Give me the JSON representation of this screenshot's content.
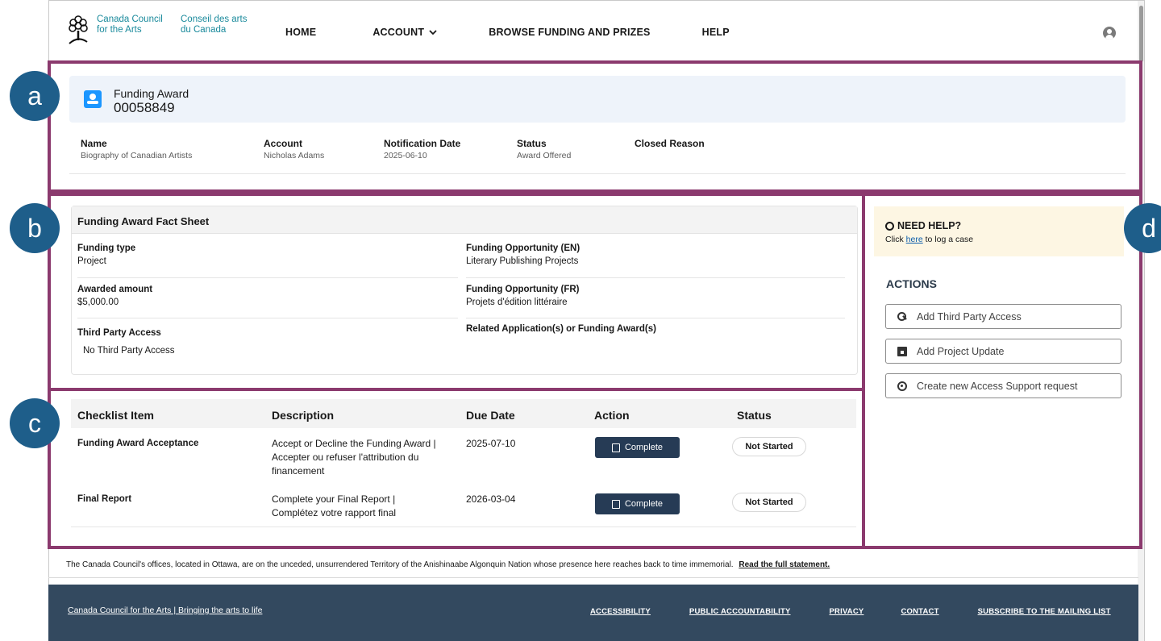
{
  "logo": {
    "en_line1": "Canada Council",
    "en_line2": "for the Arts",
    "fr_line1": "Conseil des arts",
    "fr_line2": "du Canada",
    "icon": "tree-logo-icon"
  },
  "nav": {
    "home": "HOME",
    "account": "ACCOUNT",
    "browse": "BROWSE FUNDING AND PRIZES",
    "help": "HELP"
  },
  "annotations": {
    "a": "a",
    "b": "b",
    "c": "c",
    "d": "d"
  },
  "record": {
    "type": "Funding Award",
    "number": "00058849",
    "highlights": {
      "name_label": "Name",
      "name_value": "Biography of Canadian Artists",
      "account_label": "Account",
      "account_value": "Nicholas Adams",
      "date_label": "Notification Date",
      "date_value": "2025-06-10",
      "status_label": "Status",
      "status_value": "Award Offered",
      "closed_label": "Closed Reason",
      "closed_value": ""
    }
  },
  "fact_sheet": {
    "title": "Funding Award Fact Sheet",
    "funding_type_label": "Funding type",
    "funding_type_value": "Project",
    "awarded_label": "Awarded amount",
    "awarded_value": "$5,000.00",
    "tpa_label": "Third Party Access",
    "tpa_value": "No Third Party Access",
    "opp_en_label": "Funding Opportunity (EN)",
    "opp_en_value": "Literary Publishing Projects",
    "opp_fr_label": "Funding Opportunity (FR)",
    "opp_fr_value": "Projets d'édition littéraire",
    "related_label": "Related Application(s) or Funding Award(s)"
  },
  "checklist": {
    "headers": {
      "item": "Checklist Item",
      "description": "Description",
      "due": "Due Date",
      "action": "Action",
      "status": "Status"
    },
    "rows": [
      {
        "item": "Funding Award Acceptance",
        "description": "Accept or Decline the Funding Award | Accepter ou refuser l'attribution du financement",
        "due": "2025-07-10",
        "action": "Complete",
        "status": "Not Started"
      },
      {
        "item": "Final Report",
        "description": "Complete your Final Report | Complétez votre rapport final",
        "due": "2026-03-04",
        "action": "Complete",
        "status": "Not Started"
      }
    ]
  },
  "sidebar": {
    "help_title": "NEED HELP?",
    "help_prefix": "Click",
    "help_link": "here",
    "help_suffix": "to log a case",
    "actions_title": "ACTIONS",
    "actions": [
      {
        "label": "Add Third Party Access",
        "icon": "key-icon"
      },
      {
        "label": "Add Project Update",
        "icon": "calendar-icon"
      },
      {
        "label": "Create new Access Support request",
        "icon": "lifebuoy-icon"
      }
    ]
  },
  "footer": {
    "land_ack": "The Canada Council's offices, located in Ottawa, are on the unceded, unsurrendered Territory of the Anishinaabe Algonquin Nation whose presence here reaches back to time immemorial.",
    "land_ack_link": "Read the full statement.",
    "brand": "Canada Council for the Arts | Bringing the arts to life",
    "links": [
      "ACCESSIBILITY",
      "PUBLIC ACCOUNTABILITY",
      "PRIVACY",
      "CONTACT",
      "SUBSCRIBE TO THE MAILING LIST"
    ]
  },
  "colors": {
    "annotation_border": "#8b3a6e",
    "annotation_badge": "#1e5e8a",
    "button_dark": "#263b55",
    "footer_bg": "#33495f",
    "logo_teal": "#1a8a9c"
  }
}
